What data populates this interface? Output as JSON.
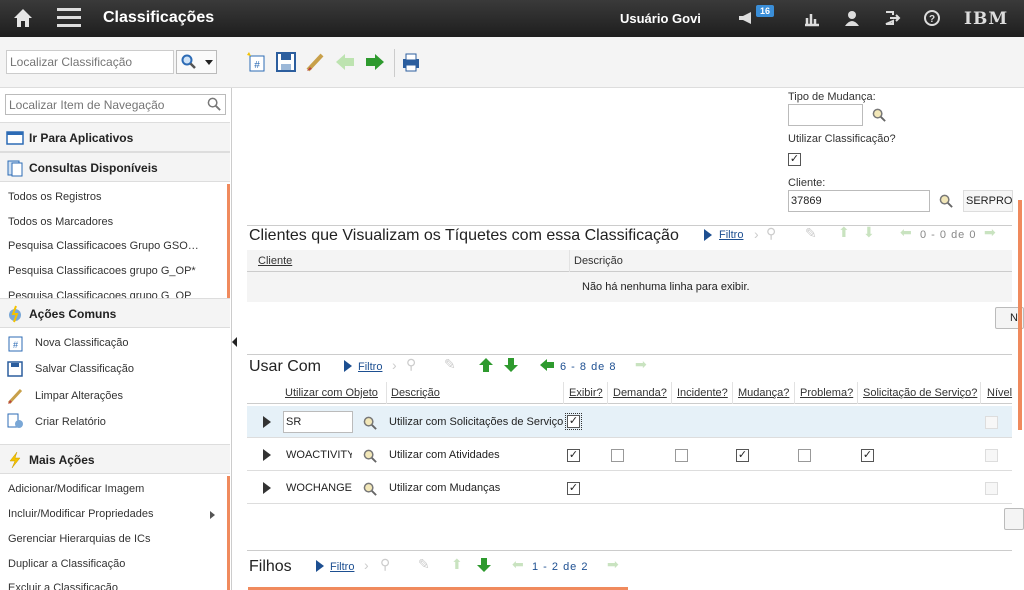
{
  "header": {
    "title": "Classificações",
    "user": "Usuário Govi",
    "badge_count": "16",
    "brand": "IBM"
  },
  "toolbar": {
    "search_placeholder": "Localizar Classificação"
  },
  "sidebar": {
    "search_placeholder": "Localizar Item de Navegação",
    "goto_apps": "Ir Para Aplicativos",
    "queries_title": "Consultas Disponíveis",
    "queries": [
      "Todos os Registros",
      "Todos os Marcadores",
      "Pesquisa Classificacoes Grupo GSO…",
      "Pesquisa Classificacoes grupo G_OP*",
      "Pesquisa Classificacoes grupo G_OP"
    ],
    "actions_title": "Ações Comuns",
    "actions": [
      "Nova Classificação",
      "Salvar Classificação",
      "Limpar Alterações",
      "Criar Relatório"
    ],
    "more_title": "Mais Ações",
    "more": [
      "Adicionar/Modificar Imagem",
      "Incluir/Modificar Propriedades",
      "Gerenciar Hierarquias de ICs",
      "Duplicar a Classificação",
      "Excluir a Classificação"
    ]
  },
  "form": {
    "tipo_label": "Tipo de Mudança:",
    "tipo_value": "",
    "utilizar_label": "Utilizar Classificação?",
    "utilizar_checked": true,
    "cliente_label": "Cliente:",
    "cliente_value": "37869",
    "cliente_desc": "SERPRO"
  },
  "clientes": {
    "title": "Clientes que Visualizam os Tíquetes com essa Classificação",
    "filter": "Filtro",
    "paging": "0 - 0 de 0",
    "columns": [
      "Cliente",
      "Descrição"
    ],
    "empty": "Não há nenhuma linha para exibir.",
    "new_btn": "N"
  },
  "usar": {
    "title": "Usar Com",
    "filter": "Filtro",
    "paging": "6 - 8 de 8",
    "columns": [
      "Utilizar com Objeto",
      "Descrição",
      "Exibir?",
      "Demanda?",
      "Incidente?",
      "Mudança?",
      "Problema?",
      "Solicitação de Serviço?",
      "Nível"
    ],
    "rows": [
      {
        "obj": "SR",
        "desc": "Utilizar com Solicitações de Serviço",
        "exibir": true,
        "demanda": null,
        "incidente": null,
        "mudanca": null,
        "problema": null,
        "solicitacao": null
      },
      {
        "obj": "WOACTIVITY",
        "desc": "Utilizar com Atividades",
        "exibir": true,
        "demanda": false,
        "incidente": false,
        "mudanca": true,
        "problema": false,
        "solicitacao": true
      },
      {
        "obj": "WOCHANGE",
        "desc": "Utilizar com Mudanças",
        "exibir": true,
        "demanda": null,
        "incidente": null,
        "mudanca": null,
        "problema": null,
        "solicitacao": null
      }
    ]
  },
  "filhos": {
    "title": "Filhos",
    "filter": "Filtro",
    "paging": "1 - 2 de 2"
  }
}
